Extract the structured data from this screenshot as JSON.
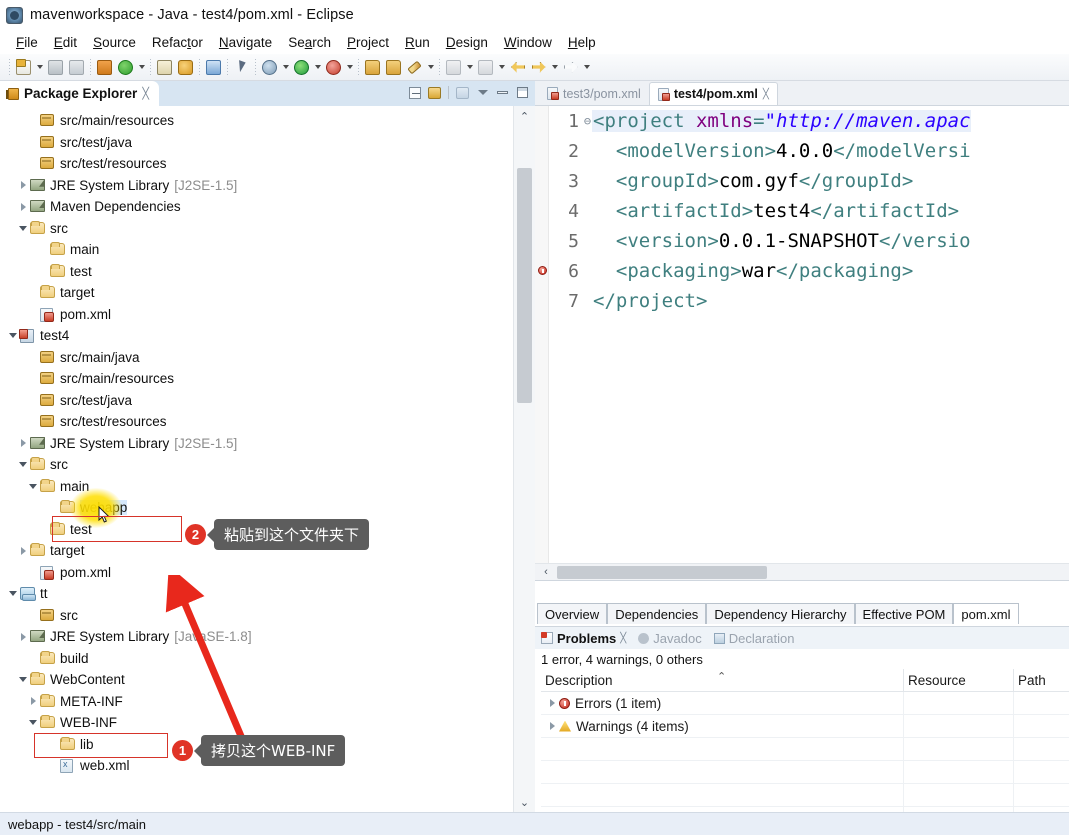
{
  "window": {
    "title": "mavenworkspace - Java - test4/pom.xml - Eclipse",
    "app_icon": "eclipse-icon"
  },
  "menubar": {
    "items": [
      "File",
      "Edit",
      "Source",
      "Refactor",
      "Navigate",
      "Search",
      "Project",
      "Run",
      "Design",
      "Window",
      "Help"
    ]
  },
  "toolbar": {
    "icons": [
      "new-wizard-icon",
      "new-dropdown-icon",
      "save-icon",
      "save-all-icon",
      "export-package-icon",
      "refresh-icon",
      "refresh-dropdown-icon",
      "open-type-icon",
      "open-task-icon",
      "console-icon",
      "skip-breakpoints-icon",
      "debug-icon",
      "debug-dropdown-icon",
      "run-icon",
      "run-dropdown-icon",
      "run-external-tools-icon",
      "external-tools-dropdown-icon",
      "new-java-project-icon",
      "new-package-icon",
      "new-class-icon",
      "new-class-dropdown-icon",
      "annotate-icon",
      "annotate-dropdown-icon",
      "search-icon",
      "search-dropdown-icon",
      "back-icon",
      "forward-icon",
      "forward-dropdown-icon",
      "next-annotation-icon",
      "next-annotation-dropdown-icon"
    ]
  },
  "package_explorer": {
    "tab_label": "Package Explorer",
    "close_glyph": "╳",
    "toolbar_icons": [
      "collapse-all-icon",
      "link-with-editor-icon",
      "view-menu-icon",
      "minimize-icon",
      "maximize-icon"
    ],
    "tree": [
      {
        "indent": 2,
        "twisty": "none",
        "icon": "package-icon",
        "label": "src/main/resources",
        "dim": ""
      },
      {
        "indent": 2,
        "twisty": "none",
        "icon": "package-icon",
        "label": "src/test/java",
        "dim": ""
      },
      {
        "indent": 2,
        "twisty": "none",
        "icon": "package-icon",
        "label": "src/test/resources",
        "dim": ""
      },
      {
        "indent": 1,
        "twisty": "collapsed",
        "icon": "library-icon",
        "label": "JRE System Library",
        "dim": "[J2SE-1.5]"
      },
      {
        "indent": 1,
        "twisty": "collapsed",
        "icon": "library-icon",
        "label": "Maven Dependencies",
        "dim": ""
      },
      {
        "indent": 1,
        "twisty": "expanded",
        "icon": "folder-icon",
        "label": "src",
        "dim": ""
      },
      {
        "indent": 3,
        "twisty": "none",
        "icon": "folder-icon",
        "label": "main",
        "dim": ""
      },
      {
        "indent": 3,
        "twisty": "none",
        "icon": "folder-icon",
        "label": "test",
        "dim": ""
      },
      {
        "indent": 2,
        "twisty": "none",
        "icon": "folder-icon",
        "label": "target",
        "dim": ""
      },
      {
        "indent": 2,
        "twisty": "none",
        "icon": "pom-xml-icon",
        "label": "pom.xml",
        "dim": ""
      },
      {
        "indent": 0,
        "twisty": "expanded",
        "icon": "maven-project-icon",
        "label": "test4",
        "dim": ""
      },
      {
        "indent": 2,
        "twisty": "none",
        "icon": "package-icon",
        "label": "src/main/java",
        "dim": ""
      },
      {
        "indent": 2,
        "twisty": "none",
        "icon": "package-icon",
        "label": "src/main/resources",
        "dim": ""
      },
      {
        "indent": 2,
        "twisty": "none",
        "icon": "package-icon",
        "label": "src/test/java",
        "dim": ""
      },
      {
        "indent": 2,
        "twisty": "none",
        "icon": "package-icon",
        "label": "src/test/resources",
        "dim": ""
      },
      {
        "indent": 1,
        "twisty": "collapsed",
        "icon": "library-icon",
        "label": "JRE System Library",
        "dim": "[J2SE-1.5]"
      },
      {
        "indent": 1,
        "twisty": "expanded",
        "icon": "folder-icon",
        "label": "src",
        "dim": ""
      },
      {
        "indent": 2,
        "twisty": "expanded",
        "icon": "folder-icon",
        "label": "main",
        "dim": ""
      },
      {
        "indent": 4,
        "twisty": "none",
        "icon": "folder-icon",
        "label": "webapp",
        "dim": "",
        "selected": true
      },
      {
        "indent": 3,
        "twisty": "none",
        "icon": "folder-icon",
        "label": "test",
        "dim": ""
      },
      {
        "indent": 1,
        "twisty": "collapsed",
        "icon": "folder-icon",
        "label": "target",
        "dim": ""
      },
      {
        "indent": 2,
        "twisty": "none",
        "icon": "pom-xml-icon",
        "label": "pom.xml",
        "dim": ""
      },
      {
        "indent": 0,
        "twisty": "expanded",
        "icon": "web-project-icon",
        "label": "tt",
        "dim": ""
      },
      {
        "indent": 2,
        "twisty": "none",
        "icon": "package-icon",
        "label": "src",
        "dim": ""
      },
      {
        "indent": 1,
        "twisty": "collapsed",
        "icon": "library-icon",
        "label": "JRE System Library",
        "dim": "[JavaSE-1.8]"
      },
      {
        "indent": 2,
        "twisty": "none",
        "icon": "folder-icon",
        "label": "build",
        "dim": ""
      },
      {
        "indent": 1,
        "twisty": "expanded",
        "icon": "folder-icon",
        "label": "WebContent",
        "dim": ""
      },
      {
        "indent": 2,
        "twisty": "collapsed",
        "icon": "folder-icon",
        "label": "META-INF",
        "dim": ""
      },
      {
        "indent": 2,
        "twisty": "expanded",
        "icon": "folder-icon",
        "label": "WEB-INF",
        "dim": ""
      },
      {
        "indent": 4,
        "twisty": "none",
        "icon": "folder-icon",
        "label": "lib",
        "dim": ""
      },
      {
        "indent": 4,
        "twisty": "none",
        "icon": "xml-file-icon",
        "label": "web.xml",
        "dim": ""
      }
    ],
    "scrollbar": {
      "up_glyph": "⌃",
      "down_glyph": "⌄"
    }
  },
  "editor": {
    "tabs": [
      {
        "label": "test3/pom.xml",
        "active": false
      },
      {
        "label": "test4/pom.xml",
        "active": true,
        "close_glyph": "╳"
      }
    ],
    "error_marker_line": 6,
    "fold_glyph": "⊖",
    "lines": [
      {
        "num": "1",
        "fold": true,
        "parts": [
          {
            "t": "tag",
            "v": "<project "
          },
          {
            "t": "attr",
            "v": "xmlns"
          },
          {
            "t": "tag",
            "v": "="
          },
          {
            "t": "val",
            "v": "\"http://maven.apac"
          }
        ]
      },
      {
        "num": "2",
        "fold": false,
        "parts": [
          {
            "t": "tag",
            "v": "  <modelVersion>"
          },
          {
            "t": "txt",
            "v": "4.0.0"
          },
          {
            "t": "tag",
            "v": "</modelVersi"
          }
        ]
      },
      {
        "num": "3",
        "fold": false,
        "parts": [
          {
            "t": "tag",
            "v": "  <groupId>"
          },
          {
            "t": "txt",
            "v": "com.gyf"
          },
          {
            "t": "tag",
            "v": "</groupId>"
          }
        ]
      },
      {
        "num": "4",
        "fold": false,
        "parts": [
          {
            "t": "tag",
            "v": "  <artifactId>"
          },
          {
            "t": "txt",
            "v": "test4"
          },
          {
            "t": "tag",
            "v": "</artifactId>"
          }
        ]
      },
      {
        "num": "5",
        "fold": false,
        "parts": [
          {
            "t": "tag",
            "v": "  <version>"
          },
          {
            "t": "txt",
            "v": "0.0.1-SNAPSHOT"
          },
          {
            "t": "tag",
            "v": "</versio"
          }
        ]
      },
      {
        "num": "6",
        "fold": false,
        "parts": [
          {
            "t": "tag",
            "v": "  <packaging>"
          },
          {
            "t": "txt",
            "v": "war"
          },
          {
            "t": "tag",
            "v": "</packaging>"
          }
        ]
      },
      {
        "num": "7",
        "fold": false,
        "parts": [
          {
            "t": "tag",
            "v": "</project>"
          }
        ]
      }
    ],
    "hscroll_left_glyph": "‹",
    "form_tabs": [
      {
        "label": "Overview",
        "active": false
      },
      {
        "label": "Dependencies",
        "active": false
      },
      {
        "label": "Dependency Hierarchy",
        "active": false
      },
      {
        "label": "Effective POM",
        "active": false
      },
      {
        "label": "pom.xml",
        "active": true
      }
    ]
  },
  "problems": {
    "tabs": [
      {
        "label": "Problems",
        "icon": "problems-icon",
        "active": true,
        "close_glyph": "╳"
      },
      {
        "label": "Javadoc",
        "icon": "javadoc-icon",
        "active": false
      },
      {
        "label": "Declaration",
        "icon": "declaration-icon",
        "active": false
      }
    ],
    "summary": "1 error, 4 warnings, 0 others",
    "columns": [
      "Description",
      "Resource",
      "Path"
    ],
    "sort_caret": "⌃",
    "rows": [
      {
        "icon": "error-icon",
        "description": "Errors (1 item)",
        "resource": "",
        "path": ""
      },
      {
        "icon": "warning-icon",
        "description": "Warnings (4 items)",
        "resource": "",
        "path": ""
      }
    ]
  },
  "statusbar": {
    "text": "webapp - test4/src/main"
  },
  "annotations": [
    {
      "badge": "1",
      "text": "拷贝这个WEB-INF"
    },
    {
      "badge": "2",
      "text": "粘贴到这个文件夹下"
    }
  ],
  "colors": {
    "accent_red": "#e03326",
    "bubble_bg": "#5d5d5d",
    "highlight_yellow": "#ffde00",
    "selection_blue": "#d5e8fb"
  }
}
